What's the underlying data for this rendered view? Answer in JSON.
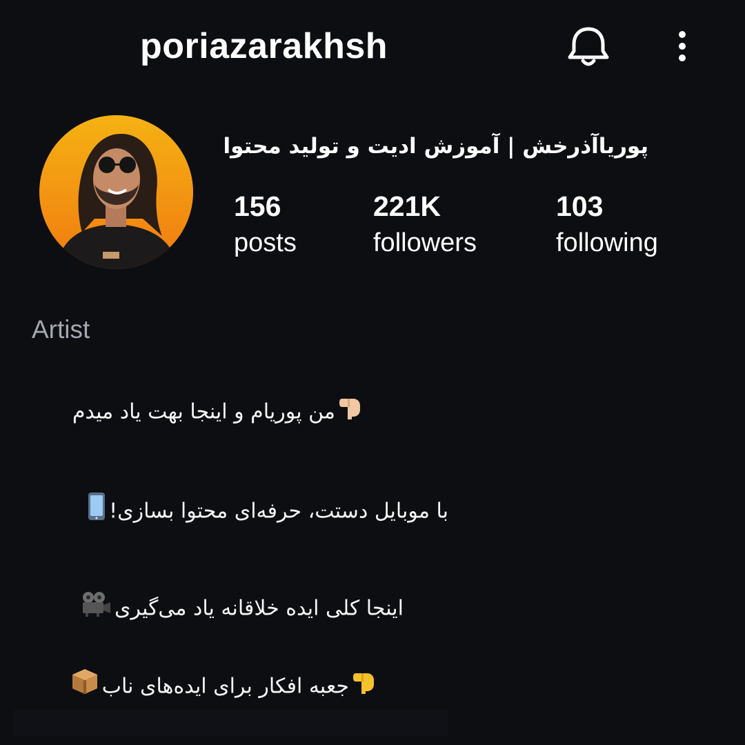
{
  "header": {
    "username": "poriazarakhsh",
    "notification_icon": "bell-icon",
    "menu_icon": "more-vertical-icon"
  },
  "profile": {
    "display_name": "پوریاآذرخش | آموزش ادیت و تولید محتوا",
    "avatar_colors": {
      "top": "#f5b213",
      "bottom": "#f07a10"
    },
    "stats": {
      "posts": {
        "value": "156",
        "label": "posts"
      },
      "followers": {
        "value": "221K",
        "label": "followers"
      },
      "following": {
        "value": "103",
        "label": "following"
      }
    },
    "category": "Artist"
  },
  "bio": {
    "lines": [
      {
        "text": "من پوریام و اینجا بهت یاد میدم",
        "emoji": "pointing-down-hand-icon"
      },
      {
        "text": "با موبایل دستت، حرفه‌ای محتوا بسازی!",
        "emoji": "mobile-phone-icon"
      },
      {
        "text": "اینجا کلی ایده خلاقانه یاد می‌گیری",
        "emoji": "film-projector-icon"
      },
      {
        "text": "جعبه افکار برای ایده‌های ناب",
        "emoji_start": "pointing-down-hand-icon",
        "emoji_end": "package-icon"
      }
    ]
  },
  "colors": {
    "background": "#0d0e12",
    "text": "#ffffff",
    "muted": "#a4a8b1"
  }
}
